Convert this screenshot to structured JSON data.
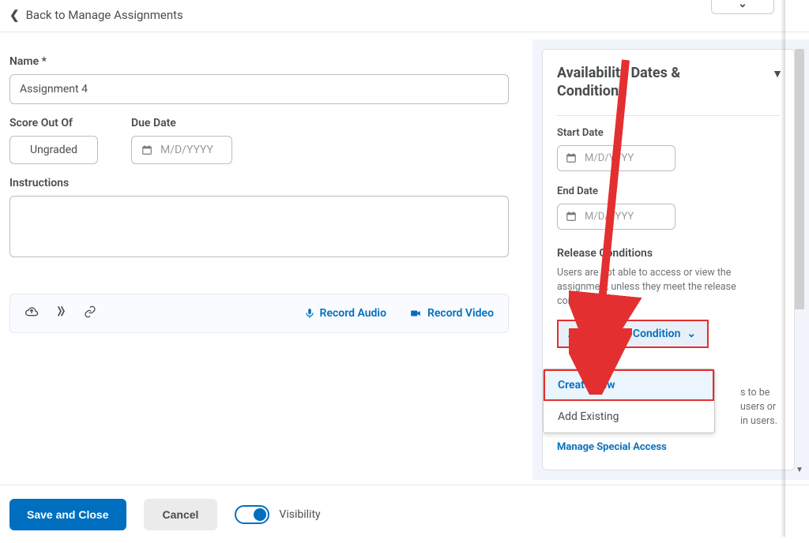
{
  "topbar": {
    "back_label": "Back to Manage Assignments"
  },
  "form": {
    "name_label": "Name *",
    "name_value": "Assignment 4",
    "score_label": "Score Out Of",
    "score_value": "Ungraded",
    "due_label": "Due Date",
    "due_placeholder": "M/D/YYYY",
    "instructions_label": "Instructions",
    "instructions_value": "",
    "record_audio": "Record Audio",
    "record_video": "Record Video"
  },
  "side": {
    "heading": "Availability Dates & Conditions",
    "start_label": "Start Date",
    "start_placeholder": "M/D/YYYY",
    "end_label": "End Date",
    "end_placeholder": "M/D/YYYY",
    "release_heading": "Release Conditions",
    "release_help": "Users are not able to access or view the assignment unless they meet the release conditions.",
    "add_release_label": "Add Release Condition",
    "dd_create": "Create New",
    "dd_existing": "Add Existing",
    "extra_txt_1": "s to be",
    "extra_txt_2": "users or",
    "extra_txt_3": "in users.",
    "manage_link": "Manage Special Access"
  },
  "footer": {
    "save": "Save and Close",
    "cancel": "Cancel",
    "visibility": "Visibility"
  }
}
